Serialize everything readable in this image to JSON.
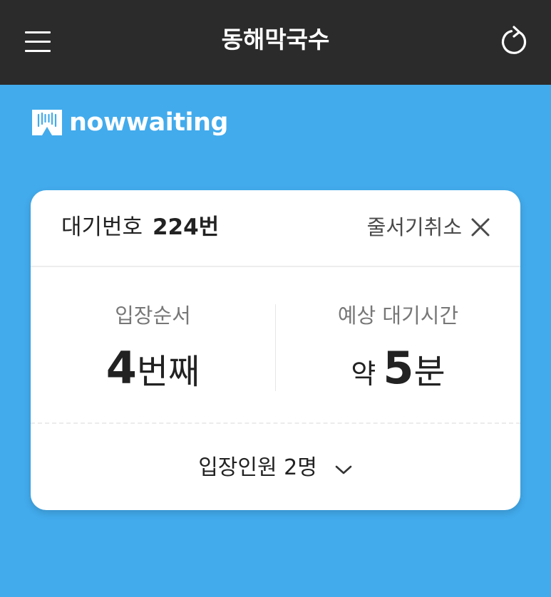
{
  "header": {
    "title": "동해막국수",
    "menu_icon": "hamburger-menu-icon",
    "refresh_icon": "refresh-icon"
  },
  "brand": {
    "logo_text": "nowwaiting",
    "logo_icon": "nowwaiting-logo-icon"
  },
  "card": {
    "ticket_label": "대기번호",
    "ticket_number": "224번",
    "cancel_label": "줄서기취소",
    "cancel_icon": "close-icon",
    "order": {
      "label": "입장순서",
      "value": "4",
      "unit": "번째"
    },
    "wait_time": {
      "label": "예상 대기시간",
      "prefix": "약",
      "value": "5",
      "unit": "분"
    },
    "party": {
      "label": "입장인원 2명",
      "icon": "chevron-down-icon"
    }
  },
  "colors": {
    "background": "#42abec",
    "topbar": "#2b2b2b",
    "card": "#ffffff",
    "text_primary": "#222222",
    "text_secondary": "#777777"
  }
}
